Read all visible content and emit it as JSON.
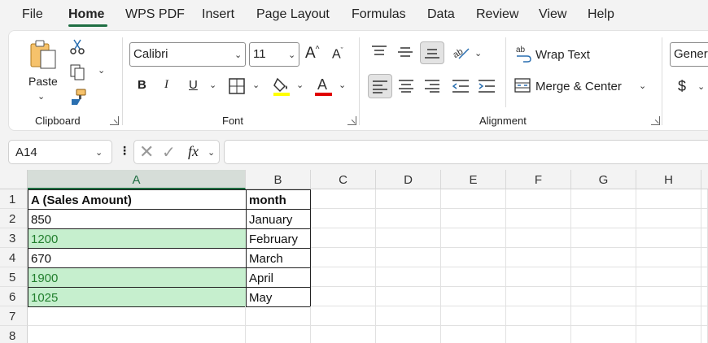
{
  "menu": {
    "tabs": [
      {
        "label": "File"
      },
      {
        "label": "Home"
      },
      {
        "label": "WPS PDF"
      },
      {
        "label": "Insert"
      },
      {
        "label": "Page Layout"
      },
      {
        "label": "Formulas"
      },
      {
        "label": "Data"
      },
      {
        "label": "Review"
      },
      {
        "label": "View"
      },
      {
        "label": "Help"
      }
    ],
    "active": "Home"
  },
  "ribbon": {
    "clipboard": {
      "paste_label": "Paste",
      "group_label": "Clipboard"
    },
    "font": {
      "font_name": "Calibri",
      "font_size": "11",
      "group_label": "Font",
      "highlight_color": "#ffff00",
      "font_color": "#e00000"
    },
    "alignment": {
      "wrap_text": "Wrap Text",
      "merge_center": "Merge & Center",
      "group_label": "Alignment"
    },
    "number": {
      "format": "General",
      "currency_symbol": "$"
    }
  },
  "formula_bar": {
    "name_box": "A14",
    "fx": "fx",
    "formula": ""
  },
  "sheet": {
    "columns": [
      "A",
      "B",
      "C",
      "D",
      "E",
      "F",
      "G",
      "H"
    ],
    "selected_column": "A",
    "rows": [
      "1",
      "2",
      "3",
      "4",
      "5",
      "6",
      "7",
      "8"
    ],
    "data": [
      [
        "A (Sales Amount)",
        "month"
      ],
      [
        "850",
        "January"
      ],
      [
        "1200",
        "February"
      ],
      [
        "670",
        "March"
      ],
      [
        "1900",
        "April"
      ],
      [
        "1025",
        "May"
      ]
    ],
    "highlight_fill": "#c6efce",
    "highlight_text": "#217f2d"
  }
}
